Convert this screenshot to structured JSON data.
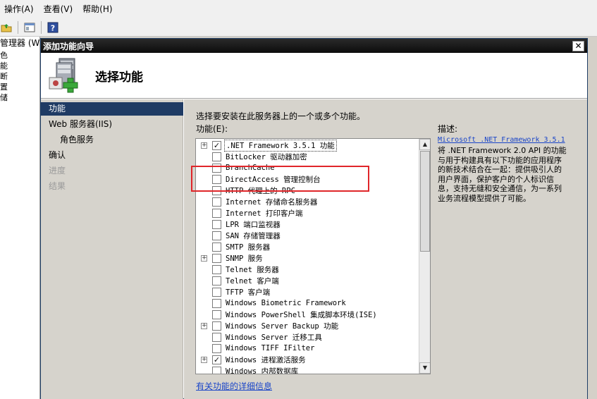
{
  "menubar": {
    "items": [
      "操作(A)",
      "查看(V)",
      "帮助(H)"
    ]
  },
  "background_tree": {
    "title": "管理器 (W",
    "items": [
      "色",
      "能",
      "断",
      "置",
      "储"
    ]
  },
  "dialog": {
    "title": "添加功能向导",
    "close_label": "✕",
    "header_title": "选择功能",
    "nav": [
      {
        "label": "功能",
        "state": "active"
      },
      {
        "label": "Web 服务器(IIS)",
        "state": "normal"
      },
      {
        "label": "角色服务",
        "state": "sub"
      },
      {
        "label": "确认",
        "state": "normal"
      },
      {
        "label": "进度",
        "state": "disabled"
      },
      {
        "label": "结果",
        "state": "disabled"
      }
    ],
    "instruction": "选择要安装在此服务器上的一个或多个功能。",
    "features_label": "功能(E):",
    "features": [
      {
        "label": ".NET Framework 3.5.1 功能",
        "expandable": true,
        "checked": true,
        "selected": true
      },
      {
        "label": "BitLocker 驱动器加密",
        "expandable": false,
        "checked": false
      },
      {
        "label": "BranchCache",
        "expandable": false,
        "checked": false
      },
      {
        "label": "DirectAccess 管理控制台",
        "expandable": false,
        "checked": false
      },
      {
        "label": "HTTP 代理上的 RPC",
        "expandable": false,
        "checked": false
      },
      {
        "label": "Internet 存储命名服务器",
        "expandable": false,
        "checked": false
      },
      {
        "label": "Internet 打印客户端",
        "expandable": false,
        "checked": false
      },
      {
        "label": "LPR 端口监视器",
        "expandable": false,
        "checked": false
      },
      {
        "label": "SAN 存储管理器",
        "expandable": false,
        "checked": false
      },
      {
        "label": "SMTP 服务器",
        "expandable": false,
        "checked": false
      },
      {
        "label": "SNMP 服务",
        "expandable": true,
        "checked": false
      },
      {
        "label": "Telnet 服务器",
        "expandable": false,
        "checked": false
      },
      {
        "label": "Telnet 客户端",
        "expandable": false,
        "checked": false
      },
      {
        "label": "TFTP 客户端",
        "expandable": false,
        "checked": false
      },
      {
        "label": "Windows Biometric Framework",
        "expandable": false,
        "checked": false
      },
      {
        "label": "Windows PowerShell 集成脚本环境(ISE)",
        "expandable": false,
        "checked": false
      },
      {
        "label": "Windows Server Backup 功能",
        "expandable": true,
        "checked": false
      },
      {
        "label": "Windows Server 迁移工具",
        "expandable": false,
        "checked": false
      },
      {
        "label": "Windows TIFF IFilter",
        "expandable": false,
        "checked": false
      },
      {
        "label": "Windows 进程激活服务",
        "expandable": true,
        "checked": true
      },
      {
        "label": "Windows 内部数据库",
        "expandable": false,
        "checked": false
      }
    ],
    "detail_link": "有关功能的详细信息",
    "description_label": "描述:",
    "description_link": "Microsoft .NET Framework 3.5.1",
    "description_text": "将 .NET Framework 2.0 API 的功能与用于构建具有以下功能的应用程序的新技术结合在一起：提供吸引人的用户界面，保护客户的个人标识信息，支持无缝和安全通信，为一系列业务流程模型提供了可能。"
  },
  "colors": {
    "highlight_box": "#e0262a",
    "nav_active_bg": "#1f3b64",
    "link": "#1a45c8"
  },
  "icons": [
    "folder-up-icon",
    "view-icon",
    "help-icon",
    "server-add-icon"
  ]
}
